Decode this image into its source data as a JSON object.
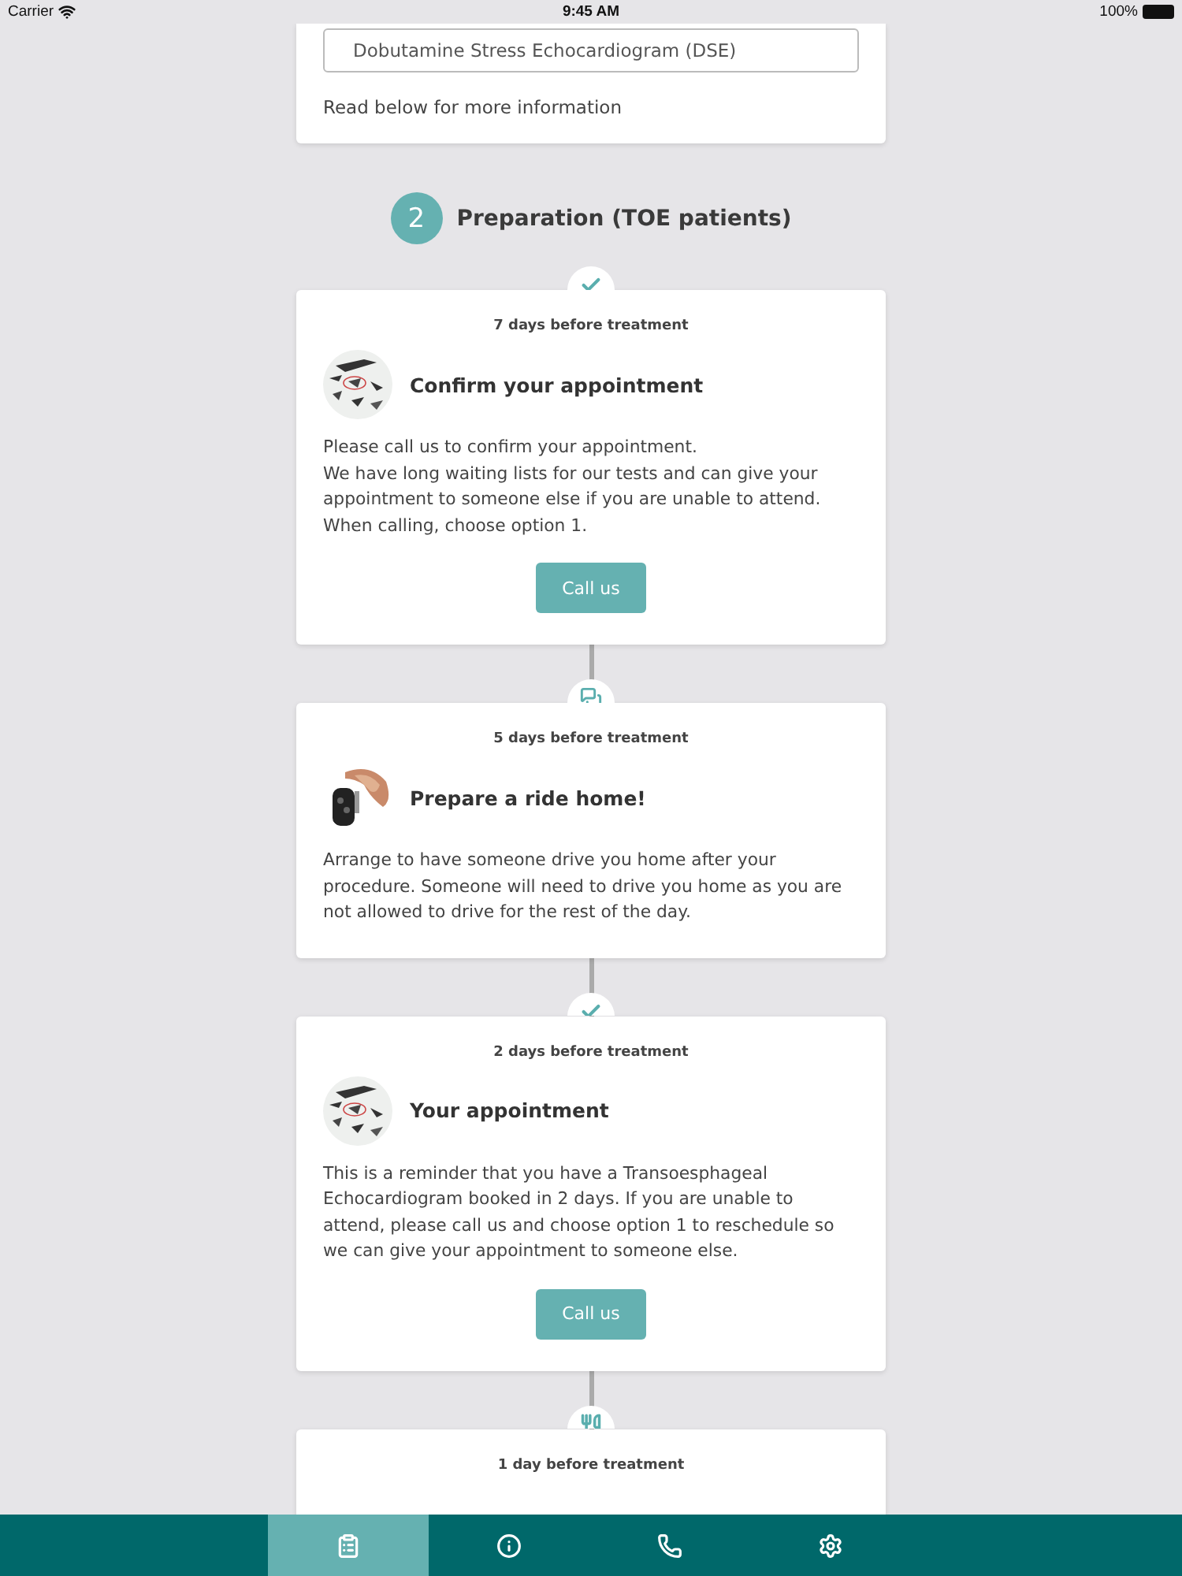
{
  "status_bar": {
    "carrier": "Carrier",
    "time": "9:45 AM",
    "battery": "100%"
  },
  "top_card": {
    "field_value": "Dobutamine Stress Echocardiogram (DSE)",
    "note": "Read below for more information"
  },
  "step": {
    "number": "2",
    "title": "Preparation (TOE patients)"
  },
  "timeline": [
    {
      "kind": "check",
      "when": "7 days before treatment",
      "image": {
        "kind": "picture"
      },
      "title": "Confirm your appointment",
      "body": [
        "Please call us to confirm your appointment.",
        "We have long waiting lists for our tests and can give your appointment to someone else if you are unable to attend. When calling, choose option 1."
      ],
      "button": "Call us"
    },
    {
      "kind": "chat",
      "when": "5 days before treatment",
      "image": {
        "kind": "picture"
      },
      "title": "Prepare a ride home!",
      "body": [
        "Arrange to have someone drive you home after your procedure. Someone will need to drive you home as you are not allowed to drive for the rest of the day."
      ]
    },
    {
      "kind": "check",
      "when": "2 days before treatment",
      "image": {
        "kind": "picture"
      },
      "title": "Your appointment",
      "body": [
        "This is a reminder that you have a Transoesphageal Echocardiogram booked in 2 days. If you are unable to attend, please call us and choose option 1 to reschedule so we can give your appointment to someone else."
      ],
      "button": "Call us"
    },
    {
      "kind": "utensils",
      "when": "1 day before treatment"
    }
  ],
  "tab_bar": [
    {
      "kind": "clipboard",
      "selected": true
    },
    {
      "kind": "info",
      "selected": false
    },
    {
      "kind": "phone",
      "selected": false
    },
    {
      "kind": "settings",
      "selected": false
    }
  ]
}
